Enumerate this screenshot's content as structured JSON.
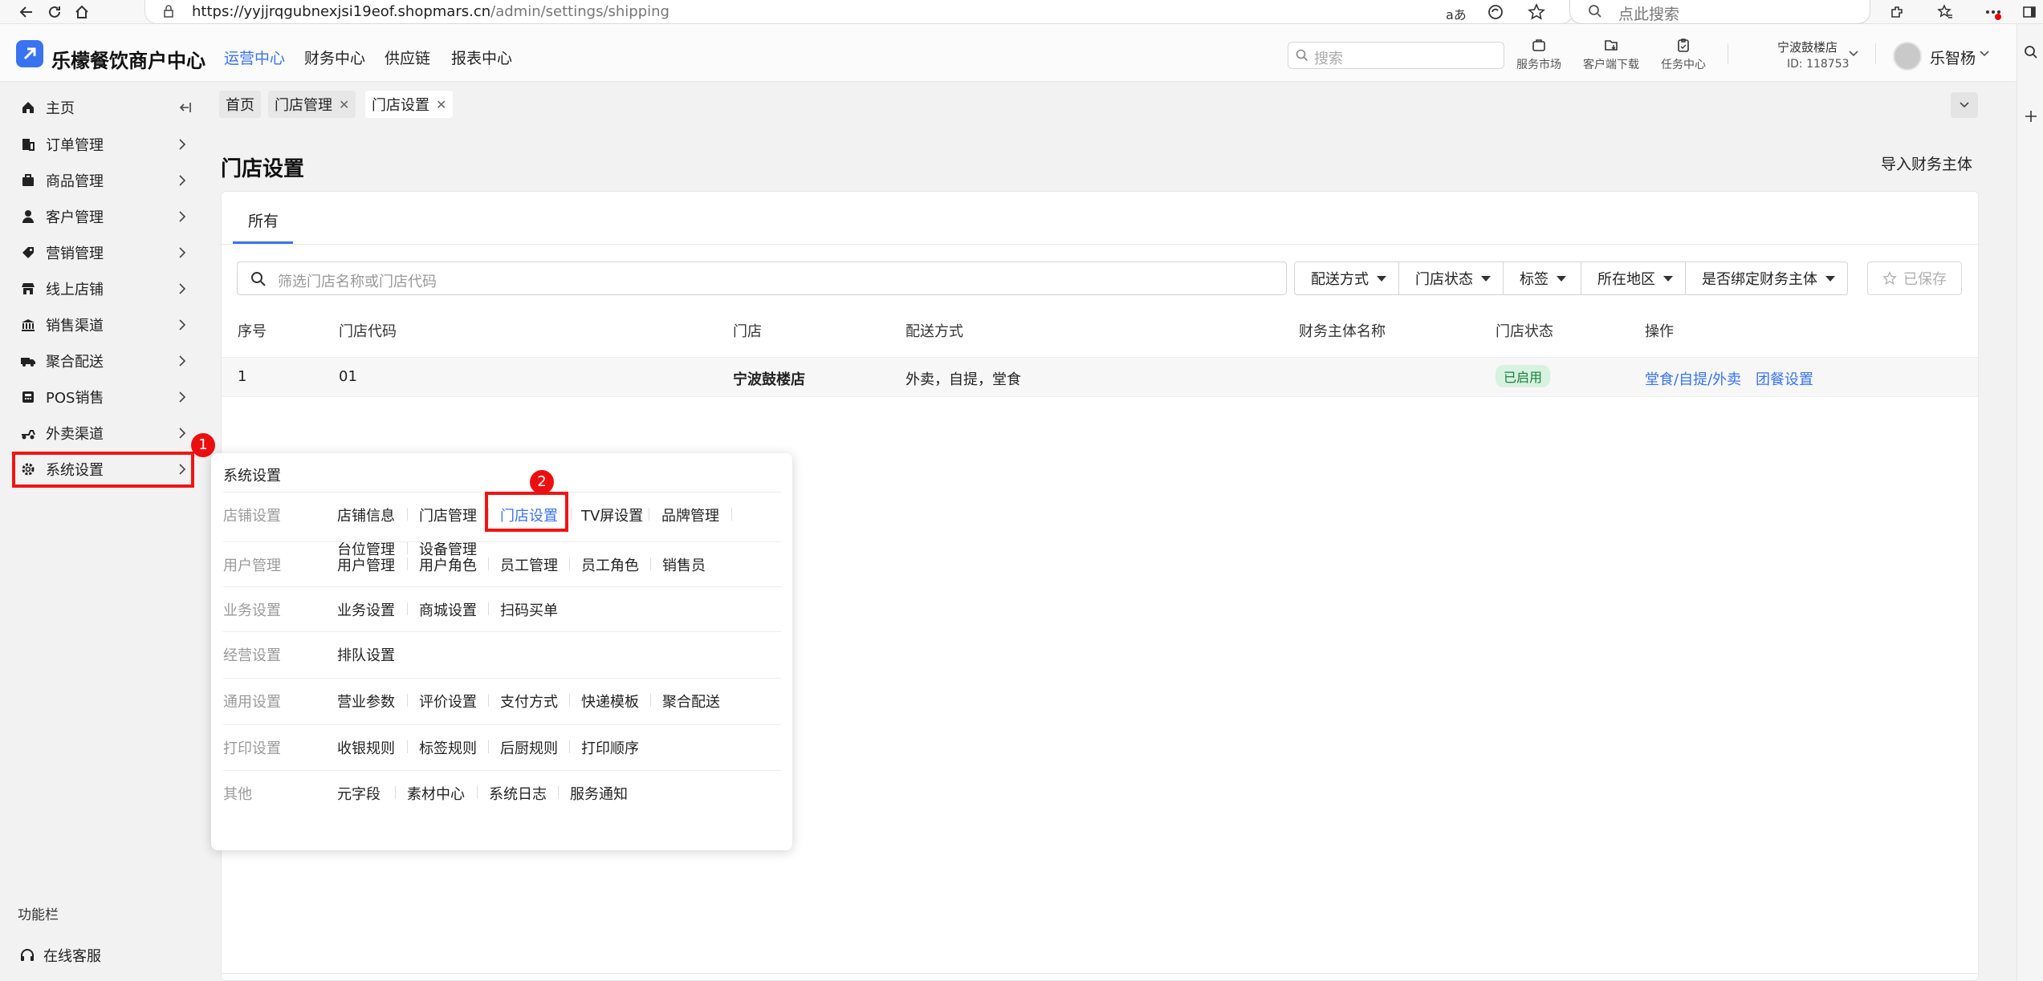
{
  "browser": {
    "url_host": "https://yyjjrqgubnexjsi19eof.shopmars.cn",
    "url_path": "/admin/settings/shipping",
    "search_placeholder": "点此搜索"
  },
  "header": {
    "brand": "乐檬餐饮商户中心",
    "nav": [
      "运营中心",
      "财务中心",
      "供应链",
      "报表中心"
    ],
    "search_placeholder": "搜索",
    "tools": [
      "服务市场",
      "客户端下载",
      "任务中心"
    ],
    "store_name": "宁波鼓楼店",
    "store_id": "ID: 118753",
    "username": "乐智杨"
  },
  "sidebar": {
    "items": [
      {
        "label": "主页",
        "icon": "home-icon"
      },
      {
        "label": "订单管理",
        "icon": "order-icon"
      },
      {
        "label": "商品管理",
        "icon": "product-icon"
      },
      {
        "label": "客户管理",
        "icon": "customer-icon"
      },
      {
        "label": "营销管理",
        "icon": "tag-icon"
      },
      {
        "label": "线上店铺",
        "icon": "store-icon"
      },
      {
        "label": "销售渠道",
        "icon": "bank-icon"
      },
      {
        "label": "聚合配送",
        "icon": "truck-icon"
      },
      {
        "label": "POS销售",
        "icon": "pos-icon"
      },
      {
        "label": "外卖渠道",
        "icon": "delivery-icon"
      },
      {
        "label": "系统设置",
        "icon": "gear-icon"
      }
    ],
    "function_label": "功能栏",
    "online_service": "在线客服"
  },
  "annotations": {
    "badge1": "1",
    "badge2": "2"
  },
  "page_tabs": {
    "home": "首页",
    "store_mgmt": "门店管理",
    "store_settings": "门店设置"
  },
  "main": {
    "title": "门店设置",
    "import_button": "导入财务主体",
    "tab_all": "所有",
    "filter_placeholder": "筛选门店名称或门店代码",
    "filters": [
      "配送方式",
      "门店状态",
      "标签",
      "所在地区",
      "是否绑定财务主体"
    ],
    "save_button": "已保存",
    "columns": [
      "序号",
      "门店代码",
      "门店",
      "配送方式",
      "财务主体名称",
      "门店状态",
      "操作"
    ],
    "rows": [
      {
        "index": "1",
        "code": "01",
        "store": "宁波鼓楼店",
        "delivery": "外卖，自提，堂食",
        "finance_entity": "",
        "status": "已启用",
        "action1": "堂食/自提/外卖",
        "action2": "团餐设置"
      }
    ]
  },
  "popup": {
    "title": "系统设置",
    "groups": [
      {
        "category": "店铺设置",
        "items": [
          "店铺信息",
          "门店管理",
          "门店设置",
          "TV屏设置",
          "品牌管理",
          "台位管理",
          "设备管理"
        ]
      },
      {
        "category": "用户管理",
        "items": [
          "用户管理",
          "用户角色",
          "员工管理",
          "员工角色",
          "销售员"
        ]
      },
      {
        "category": "业务设置",
        "items": [
          "业务设置",
          "商城设置",
          "扫码买单"
        ]
      },
      {
        "category": "经营设置",
        "items": [
          "排队设置"
        ]
      },
      {
        "category": "通用设置",
        "items": [
          "营业参数",
          "评价设置",
          "支付方式",
          "快递模板",
          "聚合配送"
        ]
      },
      {
        "category": "打印设置",
        "items": [
          "收银规则",
          "标签规则",
          "后厨规则",
          "打印顺序"
        ]
      },
      {
        "category": "其他",
        "items": [
          "元字段",
          "素材中心",
          "系统日志",
          "服务通知"
        ]
      }
    ]
  },
  "colors": {
    "accent": "#3a73ef",
    "annotation_red": "#f21414",
    "status_green": "#15803d"
  }
}
